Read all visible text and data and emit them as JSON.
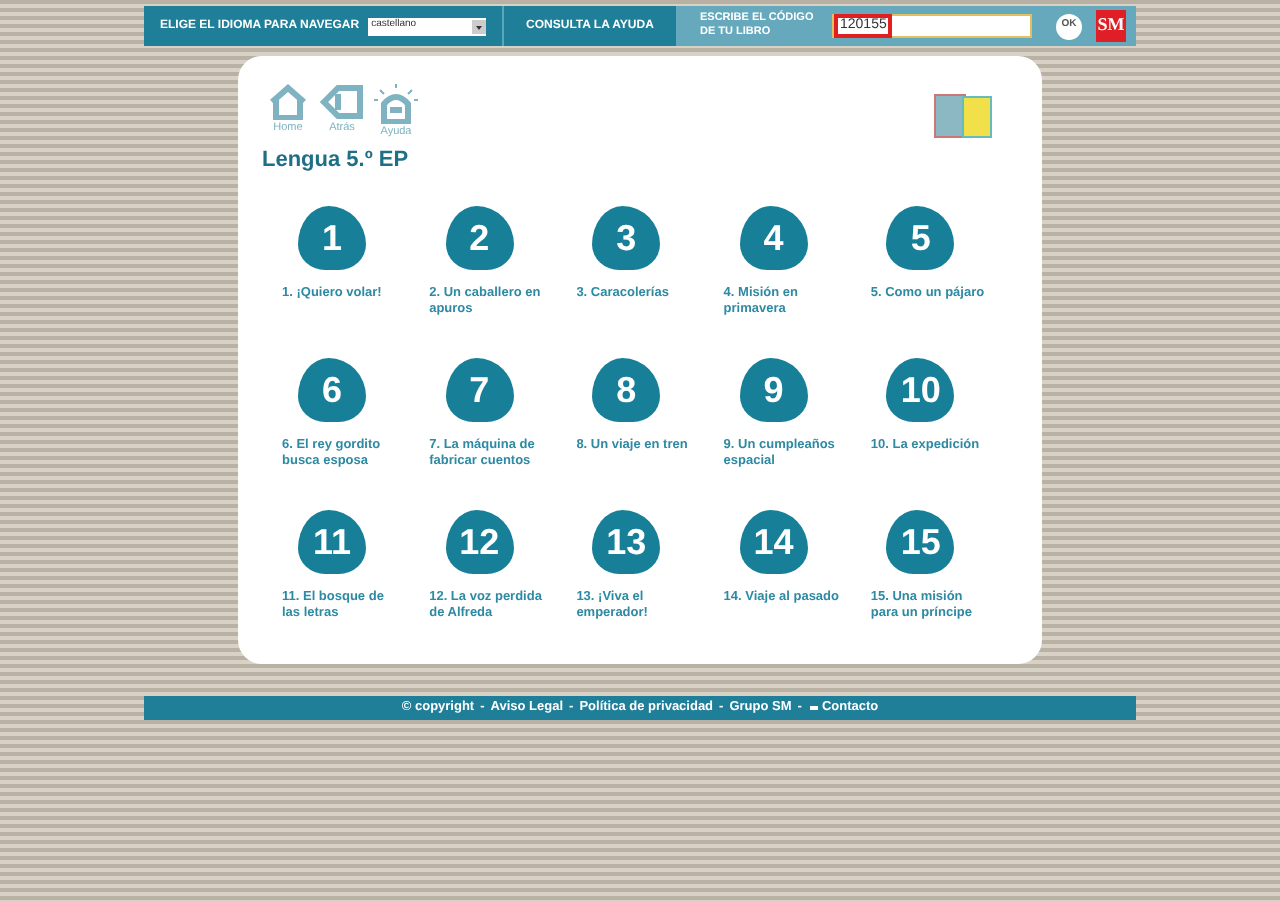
{
  "top_bar": {
    "language_label": "ELIGE EL IDIOMA PARA NAVEGAR",
    "language_value": "castellano",
    "help_link": "CONSULTA LA AYUDA",
    "code_label": "ESCRIBE EL CÓDIGO DE TU LIBRO",
    "code_value": "120155",
    "ok_button": "OK",
    "logo": "SM"
  },
  "nav": [
    {
      "label": "Home",
      "kind": "home"
    },
    {
      "label": "Atrás",
      "kind": "back"
    },
    {
      "label": "Ayuda",
      "kind": "help"
    }
  ],
  "title": "Lengua 5.º EP",
  "units": [
    {
      "number": "1",
      "label": "1. ¡Quiero volar!"
    },
    {
      "number": "2",
      "label": "2. Un caballero en apuros"
    },
    {
      "number": "3",
      "label": "3. Caracolerías"
    },
    {
      "number": "4",
      "label": "4. Misión en primavera"
    },
    {
      "number": "5",
      "label": "5. Como un pájaro"
    },
    {
      "number": "6",
      "label": "6. El rey gordito busca esposa"
    },
    {
      "number": "7",
      "label": "7. La máquina de fabricar cuentos"
    },
    {
      "number": "8",
      "label": "8. Un viaje en tren"
    },
    {
      "number": "9",
      "label": "9. Un cumpleaños espacial"
    },
    {
      "number": "10",
      "label": "10. La expedición"
    },
    {
      "number": "11",
      "label": "11. El bosque de las letras"
    },
    {
      "number": "12",
      "label": "12. La voz perdida de Alfreda"
    },
    {
      "number": "13",
      "label": "13. ¡Viva el emperador!"
    },
    {
      "number": "14",
      "label": "14. Viaje al pasado"
    },
    {
      "number": "15",
      "label": "15. Una misión para un príncipe"
    }
  ],
  "footer": {
    "separator": "-",
    "links": [
      {
        "label": "© copyright",
        "kind": "text"
      },
      {
        "label": "Aviso Legal",
        "kind": "text"
      },
      {
        "label": "Política de privacidad",
        "kind": "text"
      },
      {
        "label": "Grupo SM",
        "kind": "text"
      },
      {
        "label": "Contacto",
        "kind": "mail"
      }
    ]
  }
}
